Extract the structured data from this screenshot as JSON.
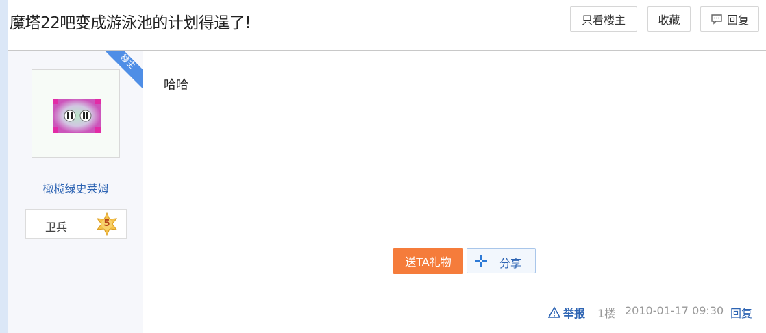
{
  "header": {
    "title": "魔塔22吧变成游泳池的计划得逞了!",
    "buttons": {
      "only_author": "只看楼主",
      "favorite": "收藏",
      "reply": "回复"
    }
  },
  "author": {
    "corner_badge": "楼主",
    "name": "橄榄绿史莱姆",
    "rank_title": "卫兵",
    "level": "5"
  },
  "post": {
    "content": "哈哈",
    "gift_button": "送TA礼物",
    "share_button": "分享",
    "footer": {
      "report": "举报",
      "floor": "1楼",
      "datetime": "2010-01-17 09:30",
      "reply": "回复"
    }
  },
  "colors": {
    "accent_blue": "#2d64b3",
    "gift_orange": "#f57c3b",
    "corner_blue": "#4f8ee6"
  }
}
